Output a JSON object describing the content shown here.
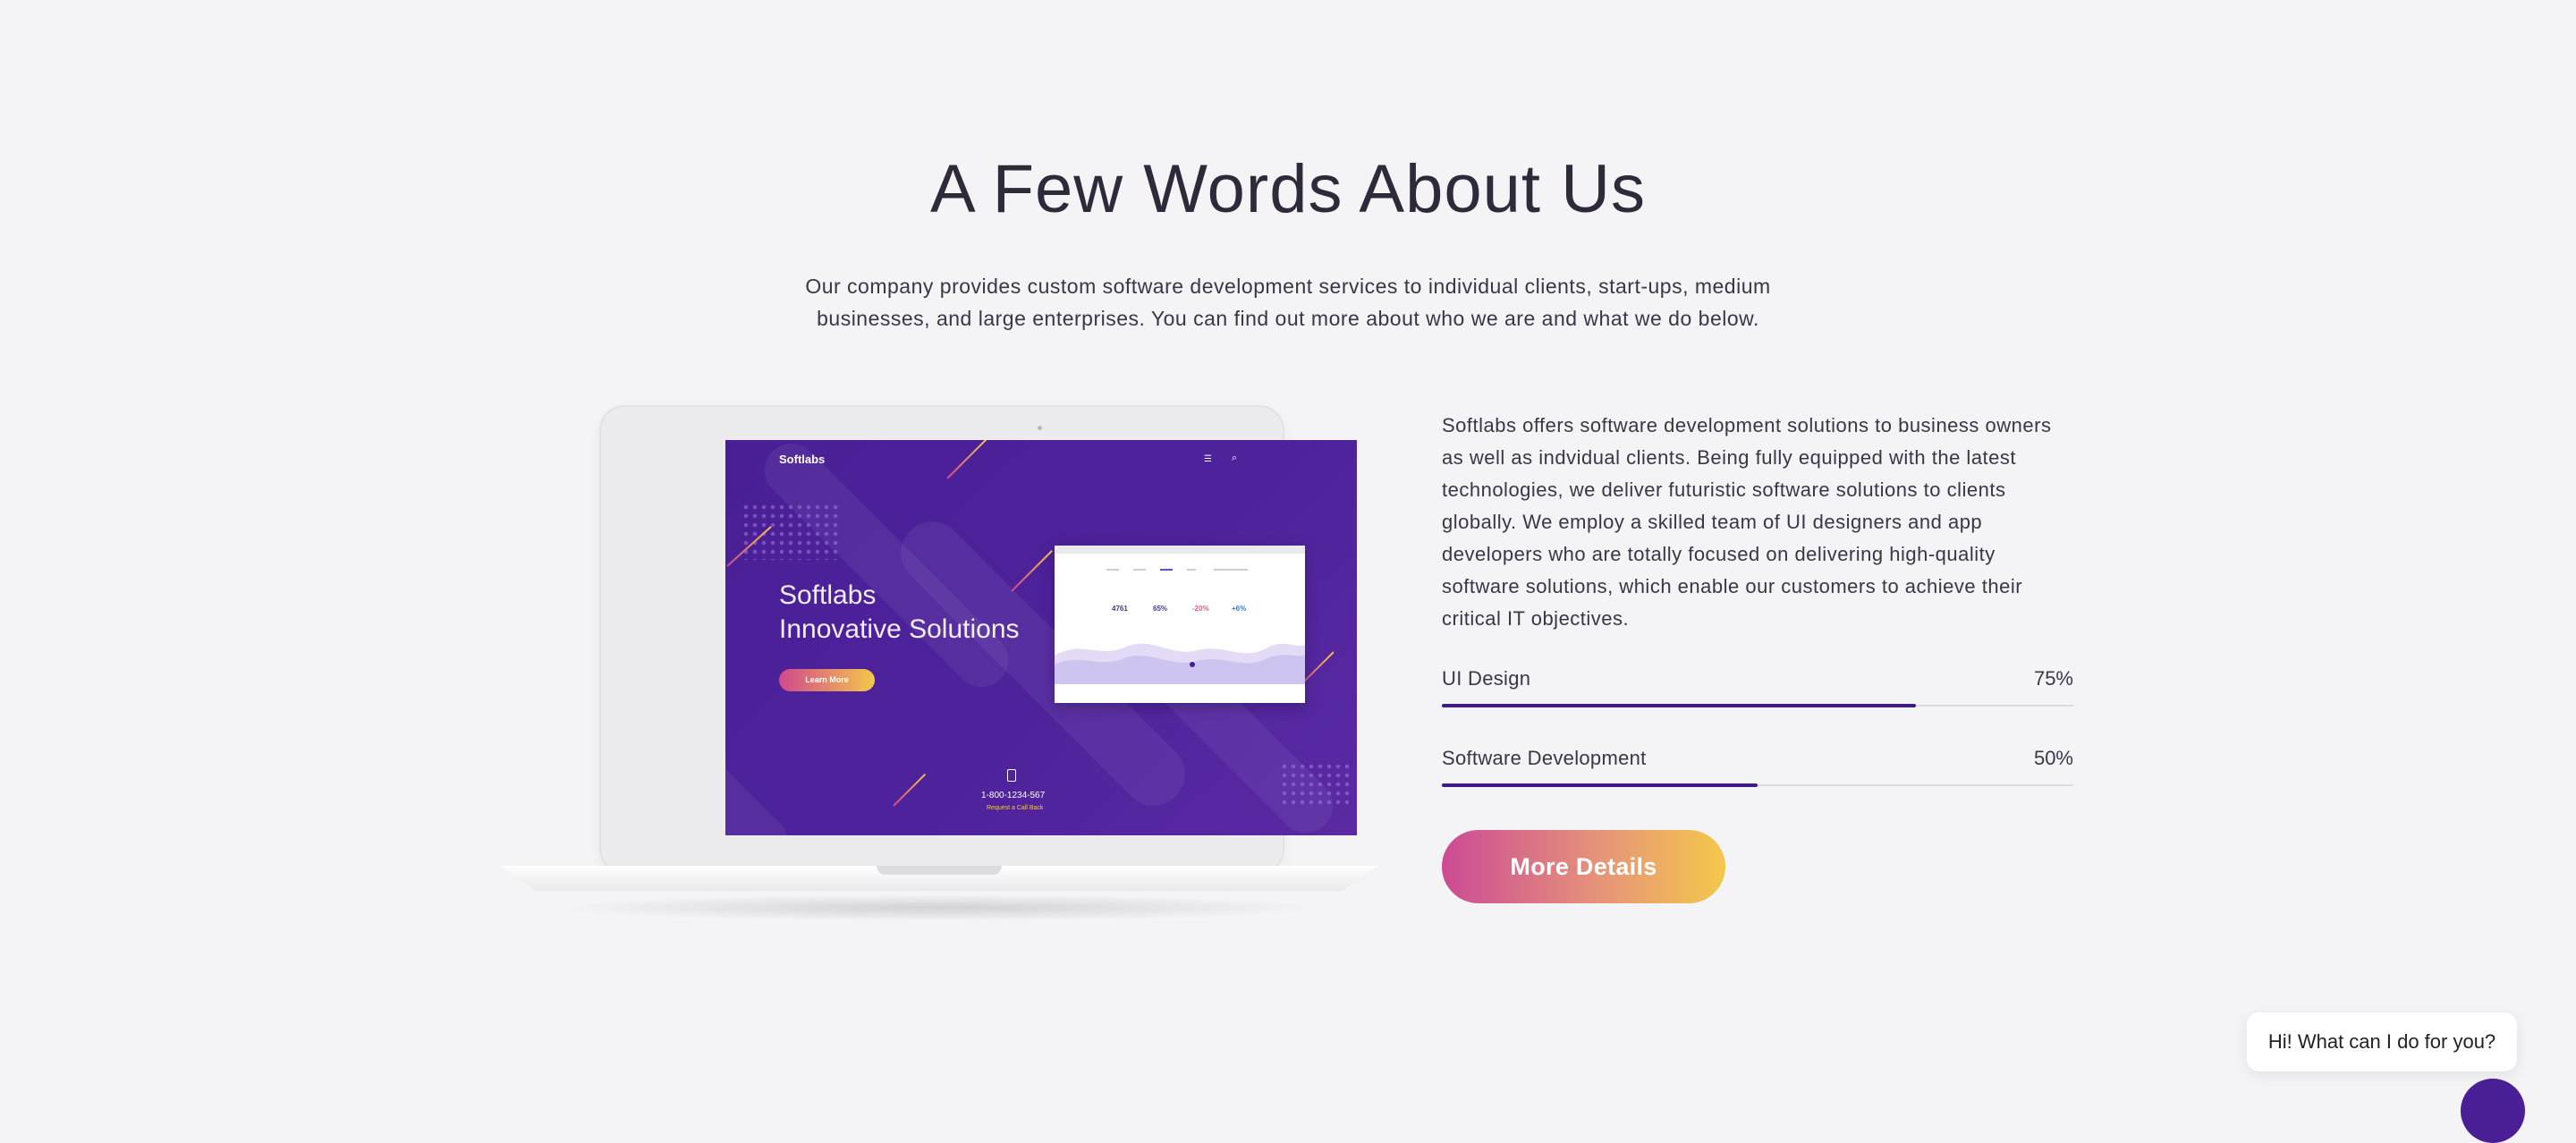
{
  "section": {
    "title": "A Few Words About Us",
    "lead": "Our company provides custom software development services to individual clients, start-ups, medium businesses, and large enterprises. You can find out more about who we are and what we do below."
  },
  "mockup": {
    "logo": "Softlabs",
    "headline_line1": "Softlabs",
    "headline_line2": "Innovative Solutions",
    "button": "Learn More",
    "phone": "1-800-1234-567",
    "callback": "Request a Call Back",
    "menu_icon": "menu-icon",
    "search_icon": "search-icon",
    "phone_icon": "phone-icon",
    "stats": [
      {
        "value": "4761",
        "color": "#4a3a8c"
      },
      {
        "value": "65%",
        "color": "#4a3a8c"
      },
      {
        "value": "-20%",
        "color": "#e25a8a"
      },
      {
        "value": "+6%",
        "color": "#3b7bd4"
      }
    ]
  },
  "about": {
    "text": "Softlabs offers software development solutions to business owners as well as indvidual clients. Being fully equipped with the latest technologies, we deliver futuristic software solutions to clients globally. We employ a skilled team of UI designers and app developers who are totally focused on delivering high-quality software solutions, which enable our customers to achieve their critical IT objectives."
  },
  "skills": [
    {
      "label": "UI Design",
      "value_text": "75%",
      "value": 0.75
    },
    {
      "label": "Software Development",
      "value_text": "50%",
      "value": 0.5
    }
  ],
  "cta": {
    "label": "More Details"
  },
  "chat": {
    "greeting": "Hi! What can I do for you?"
  },
  "colors": {
    "accent": "#3e1a8a",
    "gradient_start": "#cc4a95",
    "gradient_end": "#f4c84a",
    "background": "#f4f4f6"
  }
}
